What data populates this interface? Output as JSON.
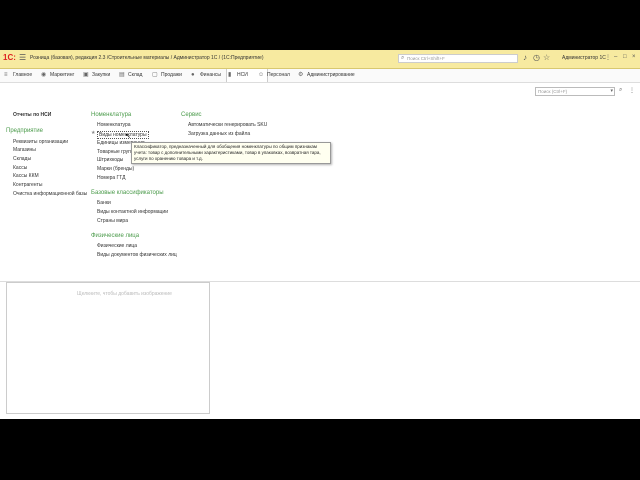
{
  "titlebar": {
    "logo": "1C:",
    "title": "Розница (базовая), редакция 2.3 /Строительные материалы / Администратор 1С / (1С:Предприятие)",
    "search_placeholder": "Поиск Ctrl+Shift+F",
    "user": "Администратор 1С"
  },
  "sections": [
    {
      "label": "Главное"
    },
    {
      "label": "Маркетинг"
    },
    {
      "label": "Закупки"
    },
    {
      "label": "Склад"
    },
    {
      "label": "Продажи"
    },
    {
      "label": "Финансы"
    },
    {
      "label": "НСИ"
    },
    {
      "label": "Персонал"
    },
    {
      "label": "Администрирование"
    }
  ],
  "panel": {
    "search_placeholder": "Поиск (Ctrl+F)"
  },
  "left": {
    "reports": "Отчеты по НСИ",
    "group": "Предприятие",
    "items": [
      "Реквизиты организации",
      "Магазины",
      "Склады",
      "Кассы",
      "Кассы ККМ",
      "Контрагенты",
      "Очистка информационной базы"
    ]
  },
  "nomenclature": {
    "title": "Номенклатура",
    "items": [
      "Номенклатура",
      "Виды номенклатуры",
      "Единицы измерения",
      "Товарные группы",
      "Штрихкоды",
      "Марки (бренды)",
      "Номера ГТД"
    ]
  },
  "basic": {
    "title": "Базовые классификаторы",
    "items": [
      "Банки",
      "Виды контактной информации",
      "Страны мира"
    ]
  },
  "persons": {
    "title": "Физические лица",
    "items": [
      "Физические лица",
      "Виды документов физических лиц"
    ]
  },
  "service": {
    "title": "Сервис",
    "items": [
      "Автоматически генерировать SKU",
      "Загрузка данных из файла"
    ]
  },
  "tooltip": "Классификатор, предназначенный для обобщения номенклатуры по общим признакам учета: товар с дополнительными характеристиками, товар в упаковках, возвратная тара, услуги по хранению товара и т.д.",
  "bottom": {
    "placeholder": "Щелкните, чтобы добавить изображение"
  }
}
